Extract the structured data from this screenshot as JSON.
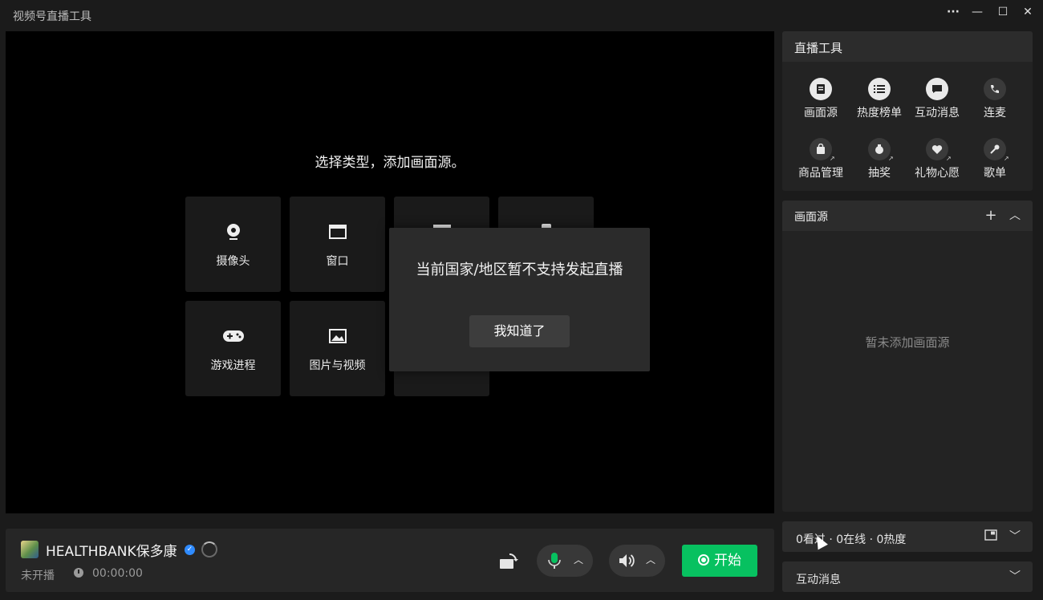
{
  "window": {
    "title": "视频号直播工具",
    "more_label": "···",
    "minimize_label": "—",
    "maximize_label": "☐",
    "close_label": "✕"
  },
  "preview": {
    "prompt": "选择类型，添加画面源。",
    "sources": [
      {
        "label": "摄像头",
        "icon": "camera-icon"
      },
      {
        "label": "窗口",
        "icon": "window-icon"
      },
      {
        "label": "",
        "icon": "screen-icon"
      },
      {
        "label": "",
        "icon": "phone-icon"
      },
      {
        "label": "游戏进程",
        "icon": "gamepad-icon"
      },
      {
        "label": "图片与视频",
        "icon": "image-icon"
      },
      {
        "label": "",
        "icon": "blank-icon"
      }
    ]
  },
  "modal": {
    "message": "当前国家/地区暂不支持发起直播",
    "confirm_label": "我知道了"
  },
  "account": {
    "name": "HEALTHBANK保多康",
    "verified_mark": "✓",
    "status": "未开播",
    "timer": "00:00:00"
  },
  "controls": {
    "start_label": "开始",
    "mic_caret": "︿",
    "speaker_caret": "︿",
    "colors": {
      "start": "#07c160",
      "mic": "#07c160"
    }
  },
  "tools_panel": {
    "title": "直播工具",
    "tools": [
      {
        "label": "画面源",
        "icon": "source-doc-icon"
      },
      {
        "label": "热度榜单",
        "icon": "list-icon"
      },
      {
        "label": "互动消息",
        "icon": "chat-icon"
      },
      {
        "label": "连麦",
        "icon": "call-icon"
      },
      {
        "label": "商品管理",
        "icon": "shopping-bag-icon"
      },
      {
        "label": "抽奖",
        "icon": "lottery-icon"
      },
      {
        "label": "礼物心愿",
        "icon": "gift-heart-icon"
      },
      {
        "label": "歌单",
        "icon": "microphone-song-icon"
      }
    ]
  },
  "sources_panel": {
    "title": "画面源",
    "add_label": "+",
    "collapse_label": "︿",
    "empty_text": "暂未添加画面源"
  },
  "stats_panel": {
    "text": "0看过 · 0在线 · 0热度",
    "expand_label": "﹀"
  },
  "messages_panel": {
    "title": "互动消息",
    "expand_label": "﹀"
  }
}
